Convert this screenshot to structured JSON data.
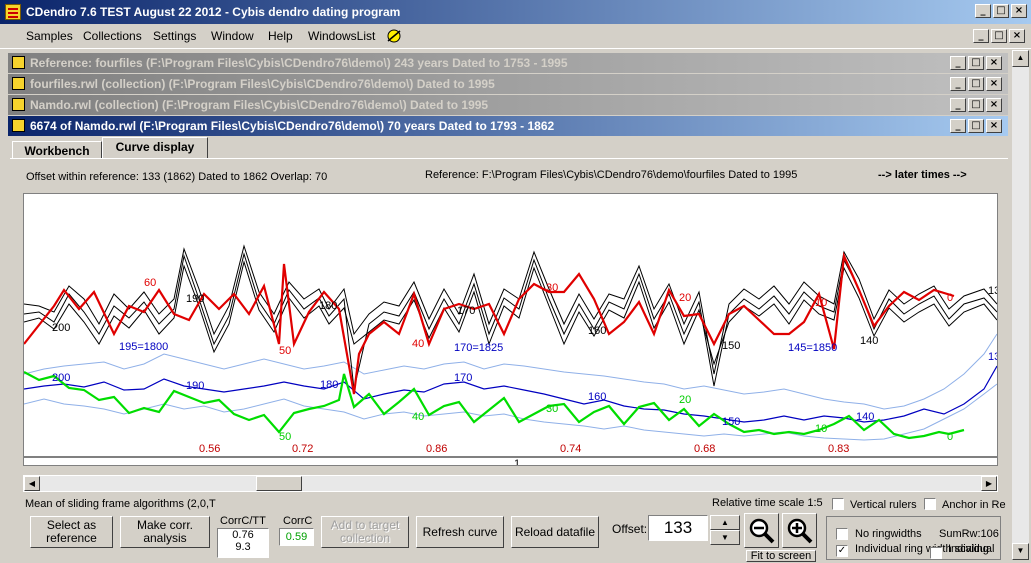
{
  "app": {
    "title": "CDendro 7.6  TEST August 22 2012 - Cybis dendro dating program",
    "minimize": "_",
    "restore": "□",
    "close": "×"
  },
  "menu": {
    "items": [
      "Samples",
      "Collections",
      "Settings",
      "Window",
      "Help",
      "WindowsList"
    ]
  },
  "mdi_windows": [
    {
      "title": "Reference: fourfiles     (F:\\Program Files\\Cybis\\CDendro76\\demo\\)  243 years  Dated to 1753 - 1995"
    },
    {
      "title": "fourfiles.rwl (collection)  (F:\\Program Files\\Cybis\\CDendro76\\demo\\) Dated to 1995"
    },
    {
      "title": "Namdo.rwl (collection)  (F:\\Program Files\\Cybis\\CDendro76\\demo\\) Dated to 1995"
    },
    {
      "title": "6674 of Namdo.rwl    (F:\\Program Files\\Cybis\\CDendro76\\demo\\)  70 years  Dated to 1793 - 1862"
    }
  ],
  "tabs": {
    "workbench": "Workbench",
    "curve_display": "Curve display"
  },
  "info": {
    "offset_text": "Offset within reference:   133  (1862)   Dated to 1862  Overlap: 70",
    "reference_text": "Reference: F:\\Program Files\\Cybis\\CDendro76\\demo\\fourfiles  Dated to 1995",
    "later_times": "--> later times -->"
  },
  "plot": {
    "labels_black": [
      "200",
      "190",
      "180",
      "170",
      "160",
      "150",
      "140",
      "13"
    ],
    "labels_red": [
      "60",
      "50",
      "40",
      "30",
      "20",
      "10",
      "0"
    ],
    "labels_blue": [
      "195=1800",
      "170=1825",
      "145=1850",
      "200",
      "190",
      "180",
      "170",
      "160",
      "150",
      "140",
      "13"
    ],
    "labels_green": [
      "50",
      "40",
      "30",
      "20",
      "10",
      "0"
    ],
    "correlations": [
      "0.56",
      "0.72",
      "0.86",
      "0.74",
      "0.68",
      "0.83"
    ],
    "bottom_marker": "1"
  },
  "colors": {
    "red": "#e00000",
    "green": "#00dd00",
    "blue": "#0000c0",
    "lightblue": "#8fb0e8"
  },
  "bottom": {
    "algo_text": "Mean of sliding frame algorithms (2,0,T",
    "relative_scale": "Relative time scale 1:5",
    "vertical_rulers": "Vertical rulers",
    "anchor": "Anchor in Re",
    "select_ref": "Select as reference",
    "make_corr": "Make corr. analysis",
    "corr_tt_label": "CorrC/TT",
    "corr_tt_1": "0.76",
    "corr_tt_2": "9.3",
    "corrc_label": "CorrC",
    "corrc_value": "0.59",
    "add_target": "Add to target collection",
    "refresh": "Refresh curve",
    "reload": "Reload datafile",
    "offset_label": "Offset:",
    "offset_value": "133",
    "no_ringwidths": "No ringwidths",
    "individual_ring": "Individual ring width scaling",
    "individual": "Individual",
    "sumrw": "SumRw:106",
    "fit_screen": "Fit to screen"
  }
}
